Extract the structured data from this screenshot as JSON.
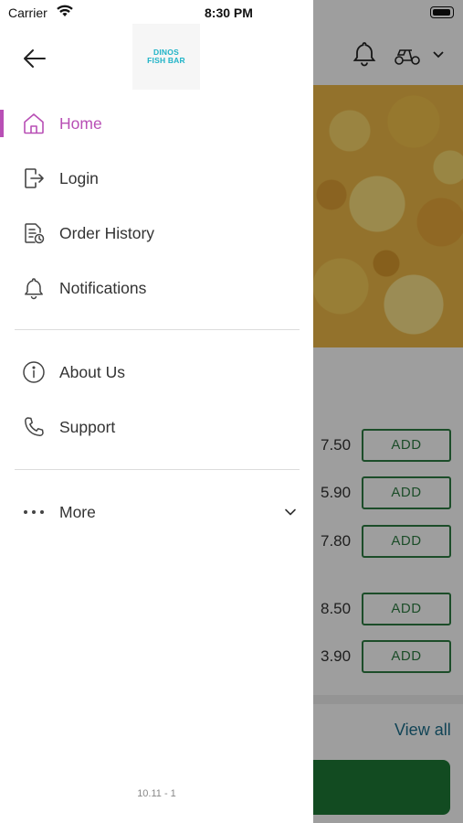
{
  "status_bar": {
    "carrier": "Carrier",
    "time": "8:30 PM"
  },
  "drawer": {
    "logo_text": [
      "DINOS",
      "FISH BAR"
    ],
    "items": [
      {
        "label": "Home",
        "icon": "home-icon",
        "active": true
      },
      {
        "label": "Login",
        "icon": "login-icon"
      },
      {
        "label": "Order History",
        "icon": "order-history-icon"
      },
      {
        "label": "Notifications",
        "icon": "bell-icon"
      },
      {
        "label": "About Us",
        "icon": "info-icon"
      },
      {
        "label": "Support",
        "icon": "phone-icon"
      },
      {
        "label": "More",
        "icon": "more-dots-icon"
      }
    ],
    "version": "10.11 - 1"
  },
  "background": {
    "prices": [
      "7.50",
      "5.90",
      "7.80",
      "8.50",
      "3.90"
    ],
    "add_label": "ADD",
    "view_all": "View all"
  },
  "colors": {
    "accent": "#b84fb5",
    "green": "#2e7d43",
    "logo": "#1fb3c7"
  }
}
